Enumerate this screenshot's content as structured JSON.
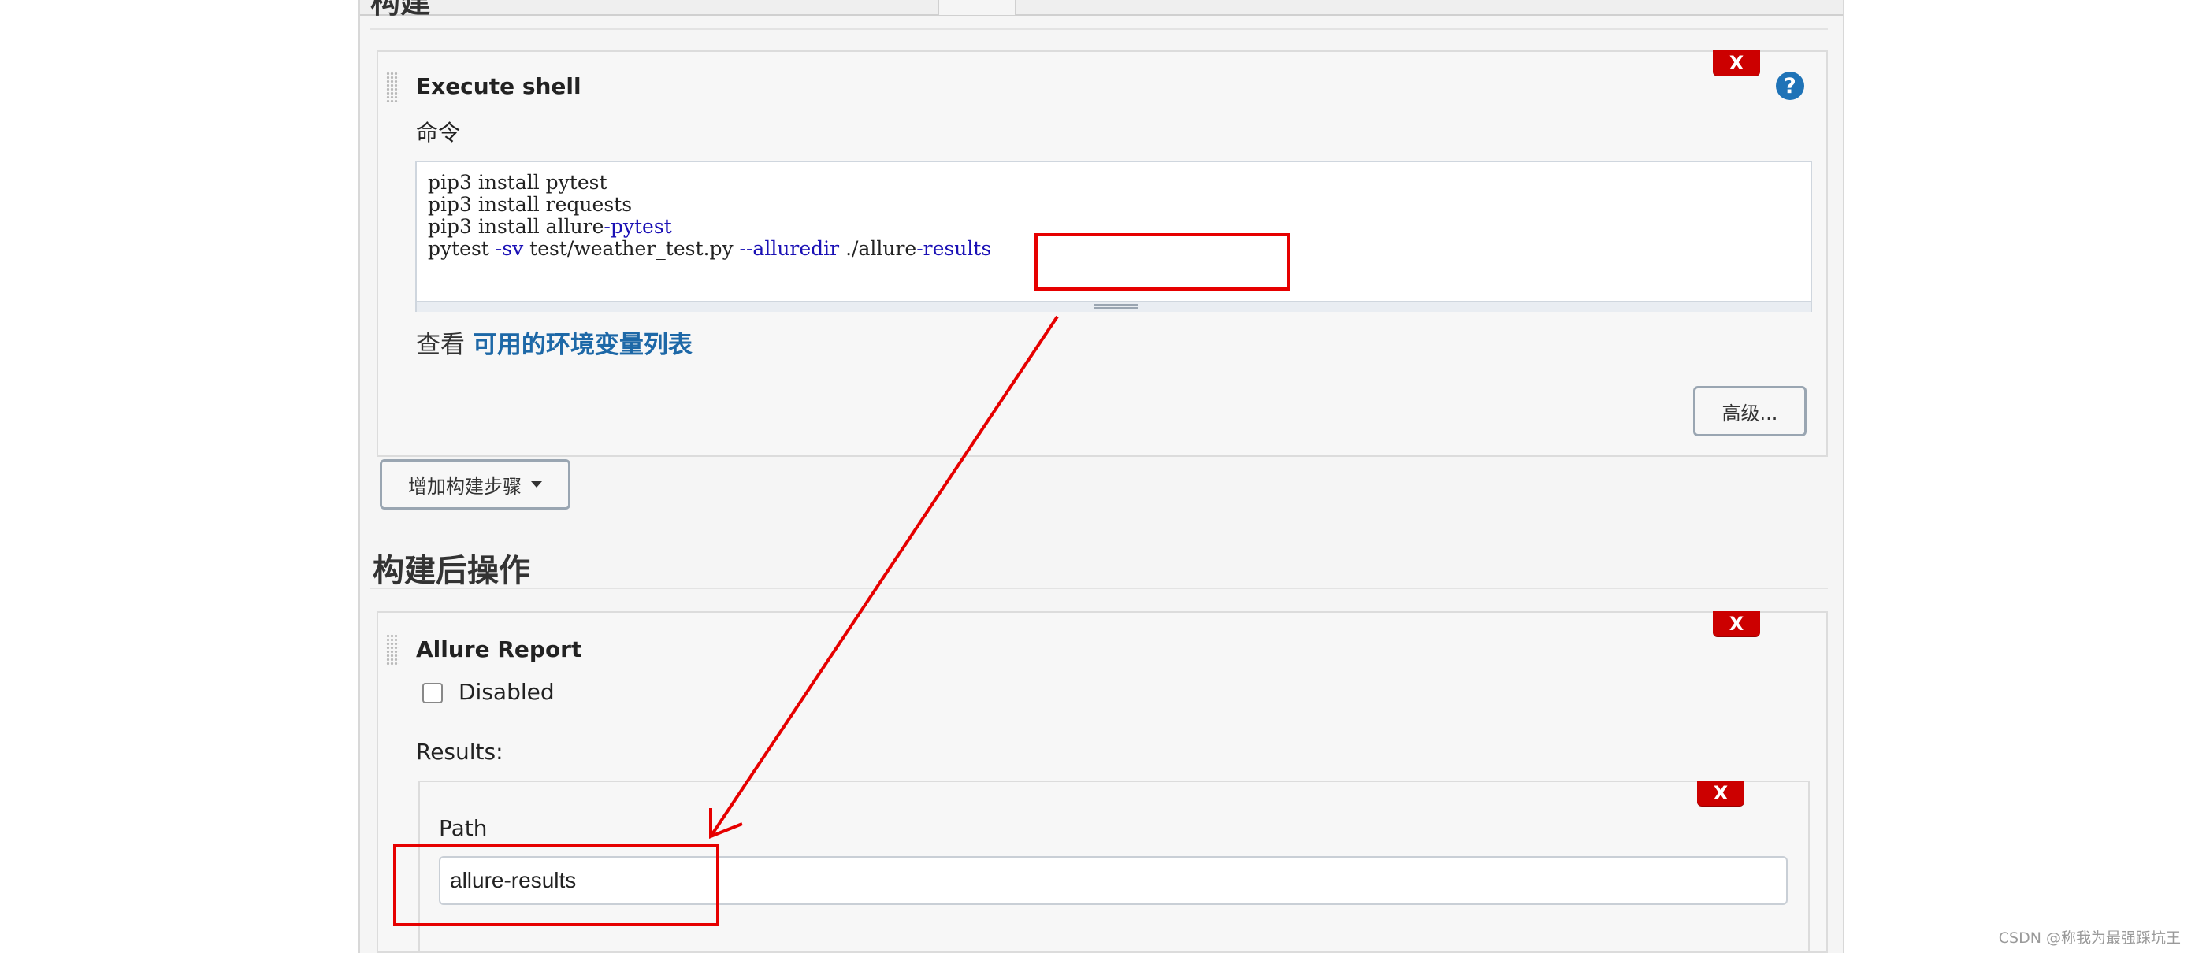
{
  "header": {
    "section_title": "构建"
  },
  "build_step": {
    "title": "Execute shell",
    "delete_label": "X",
    "help_label": "?",
    "command_label": "命令",
    "code": [
      {
        "plain": "pip3 install pytest",
        "kw": ""
      },
      {
        "plain": "pip3 install requests",
        "kw": ""
      },
      {
        "plain": "pip3 install allure",
        "kw": "-pytest"
      },
      {
        "plain": "pytest ",
        "kw": "-sv",
        "plain2": " test/weather_test.py ",
        "kw2": "--alluredir",
        "plain3": " ./allure",
        "kw3": "-results"
      }
    ],
    "env_prefix": "查看 ",
    "env_link": "可用的环境变量列表",
    "advanced_label": "高级..."
  },
  "add_step": {
    "label": "增加构建步骤"
  },
  "post_build": {
    "section_title": "构建后操作",
    "allure": {
      "title": "Allure Report",
      "delete_label": "X",
      "disabled_label": "Disabled",
      "disabled_checked": false,
      "results_label": "Results:",
      "result_delete_label": "X",
      "path_label": "Path",
      "path_value": "allure-results"
    }
  },
  "annotation": {
    "color": "#e60000"
  },
  "watermark": "CSDN @称我为最强踩坑王"
}
